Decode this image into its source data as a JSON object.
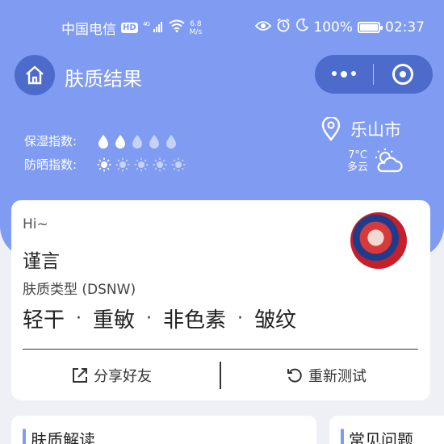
{
  "statusbar": {
    "carrier": "中国电信",
    "hd": "HD",
    "network": "4G",
    "speed_value": "6.8",
    "speed_unit": "M/s",
    "battery": "100%",
    "time": "02:37"
  },
  "nav": {
    "title": "肤质结果"
  },
  "indices": {
    "moisture_label": "保湿指数:",
    "moisture_level": 2,
    "moisture_max": 5,
    "sunscreen_label": "防晒指数:",
    "sunscreen_level": 1,
    "sunscreen_max": 5
  },
  "location": {
    "city": "乐山市",
    "temperature": "7°C",
    "condition": "多云"
  },
  "profile": {
    "greeting": "Hi~",
    "name": "谨言",
    "skin_type": "肤质类型 (DSNW)",
    "traits": [
      "轻干",
      "重敏",
      "非色素",
      "皱纹"
    ],
    "separator": "·"
  },
  "actions": {
    "share": "分享好友",
    "retest": "重新测试"
  },
  "sections": {
    "interpretation": "肤质解读",
    "faq": "常见问题"
  },
  "colors": {
    "primary": "#7f9cf2",
    "primary_dark": "#4c6bcb",
    "background": "#eef0f6"
  }
}
